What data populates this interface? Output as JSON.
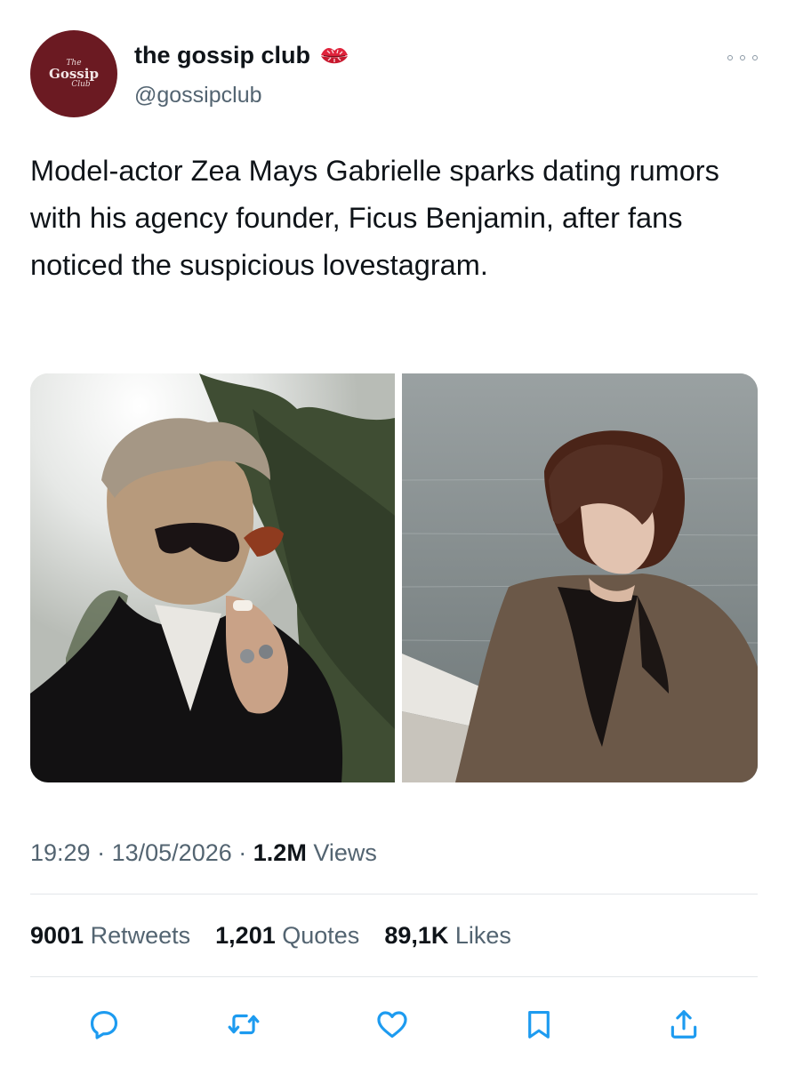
{
  "author": {
    "avatar_logo": {
      "top": "The",
      "main": "Gossip",
      "bottom": "Club"
    },
    "display_name": "the gossip club",
    "handle": "@gossipclub",
    "badge_icon": "kiss-lips-icon"
  },
  "tweet": {
    "text": "Model-actor Zea Mays Gabrielle sparks dating rumors with his agency founder, Ficus Benjamin, after fans noticed the suspicious lovestagram."
  },
  "meta": {
    "time": "19:29",
    "separator": "·",
    "date": "13/05/2026",
    "views_count": "1.2M",
    "views_label": "Views"
  },
  "stats": {
    "retweets_count": "9001",
    "retweets_label": "Retweets",
    "quotes_count": "1,201",
    "quotes_label": "Quotes",
    "likes_count": "89,1K",
    "likes_label": "Likes"
  },
  "actions": [
    "reply-icon",
    "retweet-icon",
    "like-icon",
    "bookmark-icon",
    "share-icon"
  ],
  "colors": {
    "avatar_bg": "#6b1a22",
    "text_primary": "#0f1419",
    "text_secondary": "#536471",
    "action_icon": "#1d9bf0",
    "divider": "#e3e6e9"
  }
}
